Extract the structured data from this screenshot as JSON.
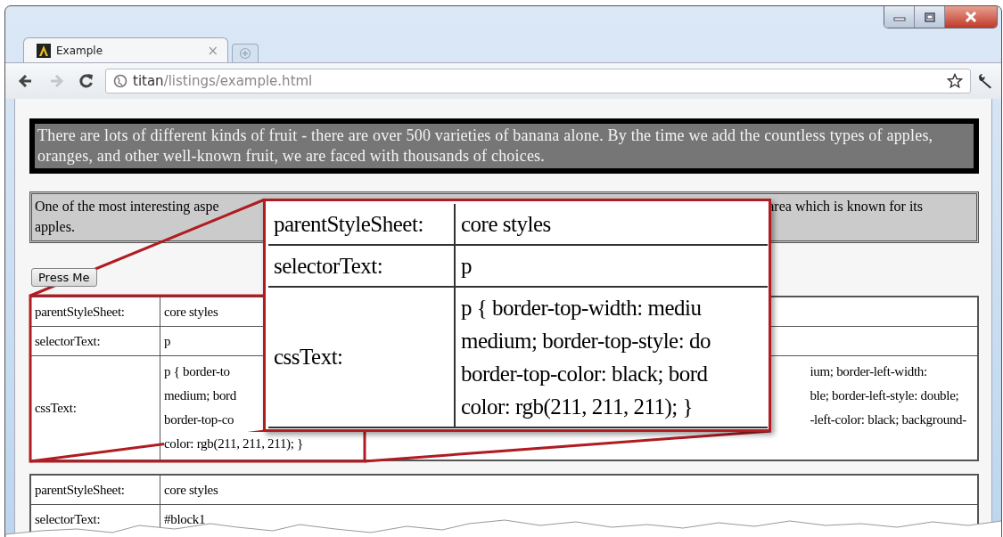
{
  "tabs": [
    {
      "title": "Example",
      "selected": true,
      "close": "×"
    }
  ],
  "nav_buttons": [
    {
      "kind": "back",
      "disabled": false
    },
    {
      "kind": "forward",
      "disabled": true
    },
    {
      "kind": "reload",
      "disabled": false
    }
  ],
  "address_bar": {
    "host": "titan",
    "path": "/listings/example.html"
  },
  "page": {
    "intro_paragraph": "There are lots of different kinds of fruit - there are over 500 varieties of banana alone. By the time we add the countless types of apples, oranges, and other well-known fruit, we are faced with thousands of choices.",
    "second_paragraph": {
      "left_lines": [
        "One of the most interesting aspe",
        "apples."
      ],
      "right_lines": [
        "area which is known for its"
      ]
    },
    "button": "Press Me",
    "tables": [
      {
        "rows": [
          {
            "label": "parentStyleSheet:",
            "value_left": [
              "core styles"
            ]
          },
          {
            "label": "selectorText:",
            "value_left": [
              "p"
            ]
          },
          {
            "label": "cssText:",
            "value_left": [
              "p { border-to",
              "medium; bord",
              "border-top-co",
              "color: rgb(211, 211, 211); }"
            ],
            "value_right": [
              "ium; border-left-width:",
              "ble; border-left-style: double;",
              "-left-color: black; background-"
            ]
          }
        ]
      },
      {
        "rows": [
          {
            "label": "parentStyleSheet:",
            "value_left": [
              "core styles"
            ]
          },
          {
            "label": "selectorText:",
            "value_left": [
              "#block1"
            ]
          }
        ]
      }
    ],
    "magnified_table": {
      "rows": [
        {
          "label": "parentStyleSheet:",
          "value_lines": [
            "core styles"
          ]
        },
        {
          "label": "selectorText:",
          "value_lines": [
            "p"
          ]
        },
        {
          "label": "cssText:",
          "value_lines": [
            "p { border-top-width: mediu",
            "medium; border-top-style: do",
            "border-top-color: black; bord",
            "color: rgb(211, 211, 211); }"
          ]
        }
      ]
    }
  }
}
